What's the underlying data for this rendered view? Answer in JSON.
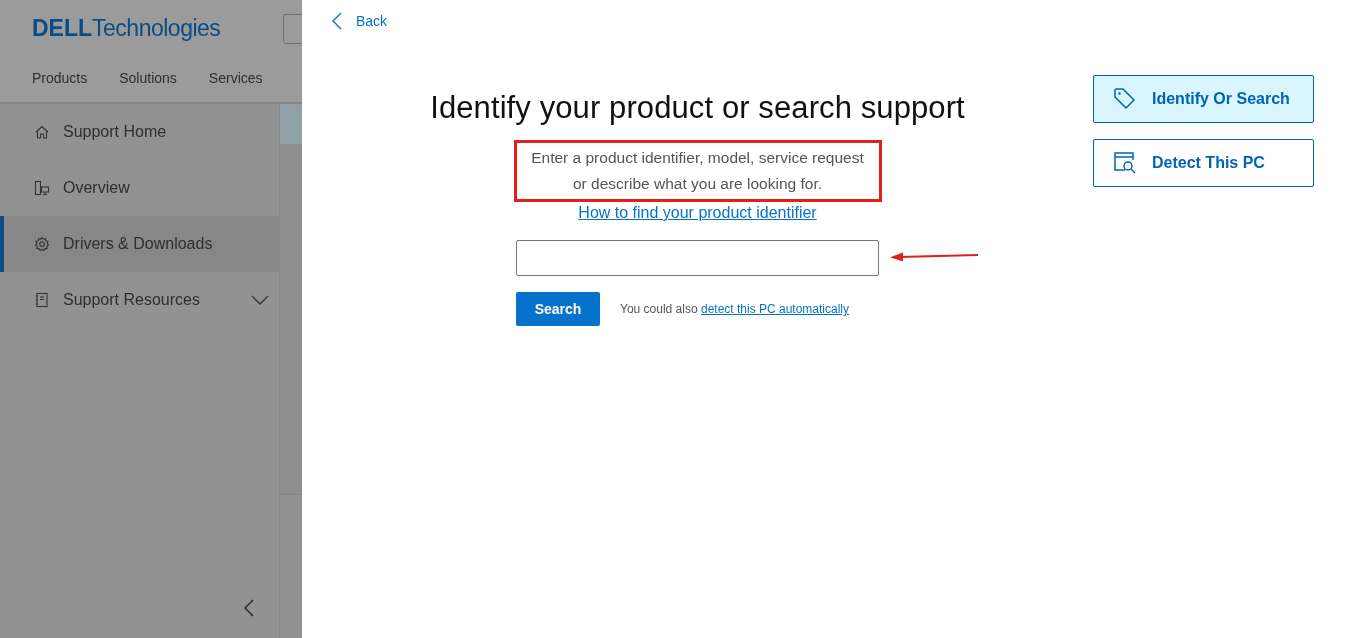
{
  "background": {
    "logo": {
      "brand": "DELL",
      "suffix": "Technologies"
    },
    "nav": [
      "Products",
      "Solutions",
      "Services"
    ],
    "sidebar": [
      {
        "label": "Support Home",
        "kind": "home",
        "selected": false,
        "expandable": false
      },
      {
        "label": "Overview",
        "kind": "devices",
        "selected": false,
        "expandable": false
      },
      {
        "label": "Drivers & Downloads",
        "kind": "gear",
        "selected": true,
        "expandable": false
      },
      {
        "label": "Support Resources",
        "kind": "book",
        "selected": false,
        "expandable": true
      }
    ]
  },
  "panel": {
    "back": "Back",
    "title": "Identify your product or search support",
    "description": {
      "text": "Enter a product identifier, model, service request or describe what you are looking for.",
      "highlighted": true
    },
    "help_link": "How to find your product identifier",
    "search_field": {
      "pointed_at": true
    },
    "search_button": "Search",
    "hint": {
      "text": "You could also ",
      "link": "detect this PC automatically"
    },
    "options": [
      {
        "label": "Identify Or Search",
        "kind": "tag",
        "selected": true
      },
      {
        "label": "Detect This PC",
        "kind": "detect",
        "selected": false
      }
    ]
  }
}
